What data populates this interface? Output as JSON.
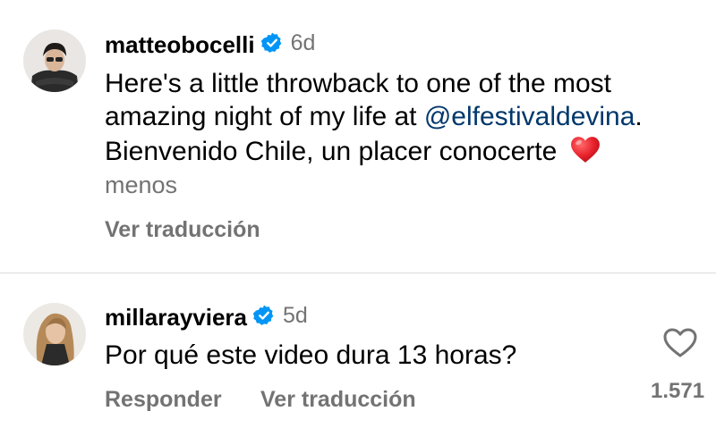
{
  "comments": [
    {
      "username": "matteobocelli",
      "time": "6d",
      "text_line1": "Here's a little throwback to one of the most",
      "text_line2_prefix": "amazing night of my life at ",
      "mention": "@elfestivaldevina",
      "text_line2_suffix": ".",
      "text_line3": "Bienvenido Chile, un placer conocerte",
      "emoji": "heart-emoji",
      "less_label": "menos",
      "translate_label": "Ver traducción"
    },
    {
      "username": "millarayviera",
      "time": "5d",
      "text": "Por qué este video dura 13 horas?",
      "reply_label": "Responder",
      "translate_label": "Ver traducción",
      "likes": "1.571"
    }
  ],
  "colors": {
    "verified": "#0095f6",
    "secondary": "#737373",
    "mention": "#00376b",
    "divider": "#dbdbdb"
  },
  "icons": [
    "verified-badge-icon",
    "heart-outline-icon",
    "red-heart-emoji"
  ]
}
